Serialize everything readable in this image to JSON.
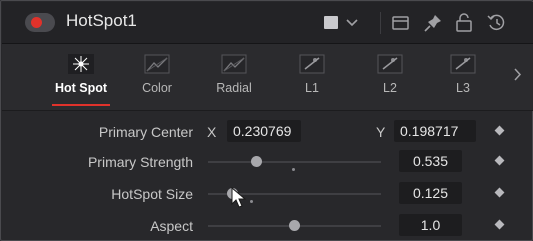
{
  "header": {
    "title": "HotSpot1",
    "enabled": true,
    "accent_color": "#e0322b",
    "icons": [
      "color-swatch-icon",
      "chevron-down-icon",
      "versions-icon",
      "pin-icon",
      "lock-icon",
      "reset-icon"
    ]
  },
  "tabs": [
    {
      "label": "Hot Spot",
      "icon": "hotspot-tab-icon",
      "active": true
    },
    {
      "label": "Color",
      "icon": "color-tab-icon",
      "active": false
    },
    {
      "label": "Radial",
      "icon": "radial-tab-icon",
      "active": false
    },
    {
      "label": "L1",
      "icon": "lens-tab-icon",
      "active": false
    },
    {
      "label": "L2",
      "icon": "lens-tab-icon",
      "active": false
    },
    {
      "label": "L3",
      "icon": "lens-tab-icon",
      "active": false
    }
  ],
  "controls": {
    "primary_center": {
      "label": "Primary Center",
      "x_label": "X",
      "x_value": "0.230769",
      "y_label": "Y",
      "y_value": "0.198717"
    },
    "primary_strength": {
      "label": "Primary Strength",
      "value": "0.535"
    },
    "hotspot_size": {
      "label": "HotSpot Size",
      "value": "0.125"
    },
    "aspect": {
      "label": "Aspect",
      "value": "1.0"
    }
  }
}
